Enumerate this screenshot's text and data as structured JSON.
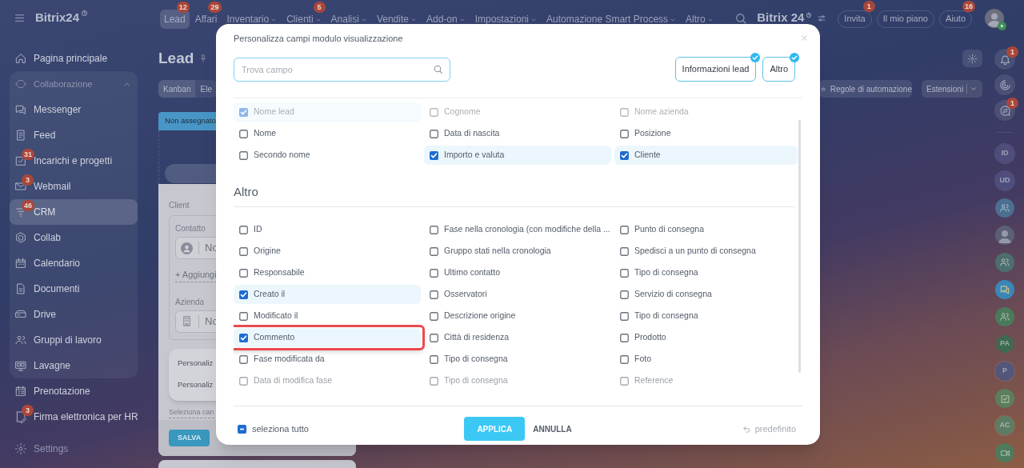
{
  "topbar": {
    "logo": "Bitrix24",
    "tabs": [
      {
        "label": "Lead",
        "badge": "12",
        "selected": true,
        "has_menu": false
      },
      {
        "label": "Affari",
        "badge": "29",
        "selected": false,
        "has_menu": false
      },
      {
        "label": "Inventario",
        "selected": false,
        "has_menu": true
      },
      {
        "label": "Clienti",
        "badge": "5",
        "selected": false,
        "has_menu": true
      },
      {
        "label": "Analisi",
        "selected": false,
        "has_menu": true
      },
      {
        "label": "Vendite",
        "selected": false,
        "has_menu": true
      },
      {
        "label": "Add-on",
        "selected": false,
        "has_menu": true
      },
      {
        "label": "Impostazioni",
        "selected": false,
        "has_menu": true
      },
      {
        "label": "Automazione Smart Process",
        "selected": false,
        "has_menu": true
      },
      {
        "label": "Altro",
        "selected": false,
        "has_menu": true
      }
    ],
    "brand": "Bitrix 24",
    "buttons": [
      {
        "label": "Invita",
        "badge": "1"
      },
      {
        "label": "Il mio piano"
      },
      {
        "label": "Aiuto",
        "badge": "16"
      }
    ]
  },
  "sidebar": {
    "items": [
      {
        "label": "Pagina principale",
        "selected": false
      },
      {
        "label": "Collaborazione",
        "expanded": true,
        "children": [
          {
            "label": "Messenger",
            "selected": false
          },
          {
            "label": "Feed",
            "selected": false
          },
          {
            "label": "Incarichi e progetti",
            "badge": "31",
            "selected": false
          },
          {
            "label": "Webmail",
            "badge": "3",
            "selected": false
          },
          {
            "label": "CRM",
            "badge": "46",
            "selected": true
          },
          {
            "label": "Collab",
            "selected": false
          },
          {
            "label": "Calendario",
            "selected": false
          },
          {
            "label": "Documenti",
            "selected": false
          },
          {
            "label": "Drive",
            "selected": false
          },
          {
            "label": "Gruppi di lavoro",
            "selected": false
          },
          {
            "label": "Lavagne",
            "selected": false
          }
        ]
      },
      {
        "label": "Prenotazione",
        "selected": false
      },
      {
        "label": "Firma elettronica per HR",
        "badge": "3",
        "selected": false
      }
    ],
    "footer": "Settings"
  },
  "page": {
    "title": "Lead",
    "view_tabs": [
      {
        "label": "Kanban",
        "selected": true
      },
      {
        "label": "Ele",
        "selected": false
      }
    ],
    "toolbar": [
      "Regole di automazione",
      "Estensioni"
    ],
    "column_header": "Non assegnato",
    "card": {
      "section": "Client",
      "contact_label": "Contatto",
      "contact_value": "No",
      "add_link": "+ Aggiungi",
      "company_label": "Azienda",
      "company_value": "No",
      "menu": [
        "Personaliz",
        "Personaliz"
      ],
      "select_link": "Seleziona can",
      "save": "SALVA"
    }
  },
  "right_rail": {
    "tools": [
      {
        "kind": "bell",
        "badge": "1"
      },
      {
        "kind": "target"
      },
      {
        "kind": "chat",
        "badge": "1"
      }
    ],
    "contacts": [
      {
        "kind": "initials",
        "initials": "ID",
        "color": "#4e4d7c"
      },
      {
        "kind": "initials",
        "initials": "UD",
        "color": "#4e4d7c"
      },
      {
        "kind": "group",
        "color": "#4a6f90"
      },
      {
        "kind": "photo",
        "color": "#5b6076"
      },
      {
        "kind": "group",
        "color": "#4d6e6e"
      },
      {
        "kind": "chat",
        "color": "#3b86b8"
      },
      {
        "kind": "group",
        "color": "#4b7a5a"
      },
      {
        "kind": "hexagon",
        "initials": "PA",
        "color": "#3e6a50"
      },
      {
        "kind": "initials",
        "initials": "P",
        "color": "#54557a"
      },
      {
        "kind": "task",
        "color": "#5c7e5c"
      },
      {
        "kind": "initials",
        "initials": "AC",
        "color": "#5d7c64"
      },
      {
        "kind": "video",
        "color": "#4f7a5c"
      }
    ]
  },
  "modal": {
    "title": "Personalizza campi modulo visualizzazione",
    "search_placeholder": "Trova campo",
    "filters": [
      {
        "label": "Informazioni lead",
        "selected": true
      },
      {
        "label": "Altro",
        "selected": true
      }
    ],
    "sections": [
      {
        "items": [
          {
            "label": "Nome lead",
            "checked": true,
            "outlined": false
          },
          {
            "label": "Cognome",
            "checked": false,
            "outlined": false
          },
          {
            "label": "Nome azienda",
            "checked": false,
            "outlined": false
          },
          {
            "label": "Nome",
            "checked": false,
            "outlined": false
          },
          {
            "label": "Data di nascita",
            "checked": false,
            "outlined": false
          },
          {
            "label": "Posizione",
            "checked": false,
            "outlined": false
          },
          {
            "label": "Secondo nome",
            "checked": false,
            "outlined": false
          },
          {
            "label": "Importo e valuta",
            "checked": true,
            "outlined": false
          },
          {
            "label": "Cliente",
            "checked": true,
            "outlined": false
          }
        ]
      },
      {
        "title": "Altro",
        "items": [
          {
            "label": "ID",
            "checked": false,
            "outlined": false
          },
          {
            "label": "Fase nella cronologia (con modifiche della ...",
            "checked": false,
            "outlined": false
          },
          {
            "label": "Punto di consegna",
            "checked": false,
            "outlined": false
          },
          {
            "label": "Origine",
            "checked": false,
            "outlined": false
          },
          {
            "label": "Gruppo stati nella cronologia",
            "checked": false,
            "outlined": false
          },
          {
            "label": "Spedisci a un punto di consegna",
            "checked": false,
            "outlined": false
          },
          {
            "label": "Responsabile",
            "checked": false,
            "outlined": false
          },
          {
            "label": "Ultimo contatto",
            "checked": false,
            "outlined": false
          },
          {
            "label": "Tipo di consegna",
            "checked": false,
            "outlined": false
          },
          {
            "label": "Creato il",
            "checked": true,
            "outlined": false
          },
          {
            "label": "Osservatori",
            "checked": false,
            "outlined": false
          },
          {
            "label": "Servizio di consegna",
            "checked": false,
            "outlined": false
          },
          {
            "label": "Modificato il",
            "checked": false,
            "outlined": false
          },
          {
            "label": "Descrizione origine",
            "checked": false,
            "outlined": false
          },
          {
            "label": "Tipo di consegna",
            "checked": false,
            "outlined": false
          },
          {
            "label": "Commento",
            "checked": true,
            "outlined": true
          },
          {
            "label": "Città di residenza",
            "checked": false,
            "outlined": false
          },
          {
            "label": "Prodotto",
            "checked": false,
            "outlined": false
          },
          {
            "label": "Fase modificata da",
            "checked": false,
            "outlined": false
          },
          {
            "label": "Tipo di consegna",
            "checked": false,
            "outlined": false
          },
          {
            "label": "Foto",
            "checked": false,
            "outlined": false
          },
          {
            "label": "Data di modifica fase",
            "checked": false,
            "outlined": false
          },
          {
            "label": "Tipo di consegna",
            "checked": false,
            "outlined": false
          },
          {
            "label": "Reference",
            "checked": false,
            "outlined": false
          }
        ]
      }
    ],
    "select_all": {
      "label": "seleziona tutto",
      "indeterminate": true
    },
    "apply": "APPLICA",
    "cancel": "ANNULLA",
    "reset": "predefinito"
  }
}
